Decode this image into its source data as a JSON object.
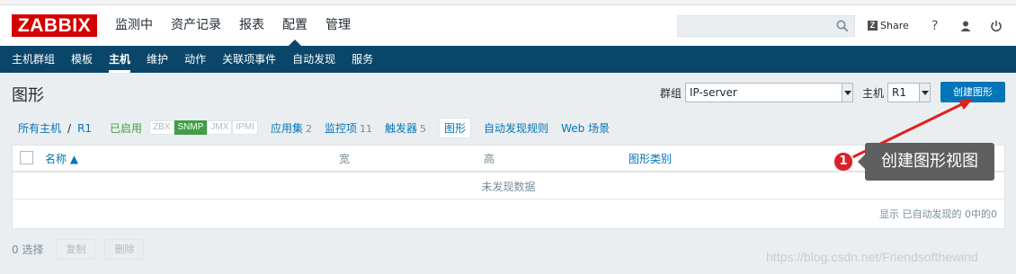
{
  "brand": {
    "logo_text": "ZABBIX"
  },
  "main_nav": [
    {
      "label": "监测中"
    },
    {
      "label": "资产记录"
    },
    {
      "label": "报表"
    },
    {
      "label": "配置"
    },
    {
      "label": "管理"
    }
  ],
  "header": {
    "share_label": "Share",
    "help_icon": "question-icon",
    "user_icon": "user-icon",
    "logout_icon": "power-icon",
    "search_placeholder": ""
  },
  "sub_nav": [
    {
      "label": "主机群组"
    },
    {
      "label": "模板"
    },
    {
      "label": "主机"
    },
    {
      "label": "维护"
    },
    {
      "label": "动作"
    },
    {
      "label": "关联项事件"
    },
    {
      "label": "自动发现"
    },
    {
      "label": "服务"
    }
  ],
  "page": {
    "title": "图形",
    "group_label": "群组",
    "group_value": "IP-server",
    "host_label": "主机",
    "host_value": "R1",
    "create_button": "创建图形"
  },
  "breadcrumb": {
    "all_hosts": "所有主机",
    "separator": "/",
    "host": "R1",
    "status": "已启用",
    "tags": [
      "ZBX",
      "SNMP",
      "JMX",
      "IPMI"
    ],
    "active_tag": "SNMP"
  },
  "host_tabs": {
    "applications": {
      "label": "应用集",
      "count": "2"
    },
    "items": {
      "label": "监控项",
      "count": "11"
    },
    "triggers": {
      "label": "触发器",
      "count": "5"
    },
    "graphs": {
      "label": "图形"
    },
    "discovery": {
      "label": "自动发现规则"
    },
    "web": {
      "label": "Web 场景"
    }
  },
  "table": {
    "columns": [
      {
        "label": "名称 ▲"
      },
      {
        "label": "宽"
      },
      {
        "label": "高"
      },
      {
        "label": "图形类别"
      }
    ],
    "empty_text": "未发现数据",
    "footer_text": "显示 已自动发现的 0中的0"
  },
  "actions": {
    "selected": "0 选择",
    "copy": "复制",
    "delete": "删除"
  },
  "annotation": {
    "number": "1",
    "text": "创建图形视图",
    "color": "#d9222a"
  },
  "watermark": "https://blog.csdn.net/Friendsofthewind",
  "colors": {
    "brand_red": "#d40000",
    "nav_blue": "#0a466a",
    "link_blue": "#0275b8",
    "enabled_green": "#429e47"
  }
}
